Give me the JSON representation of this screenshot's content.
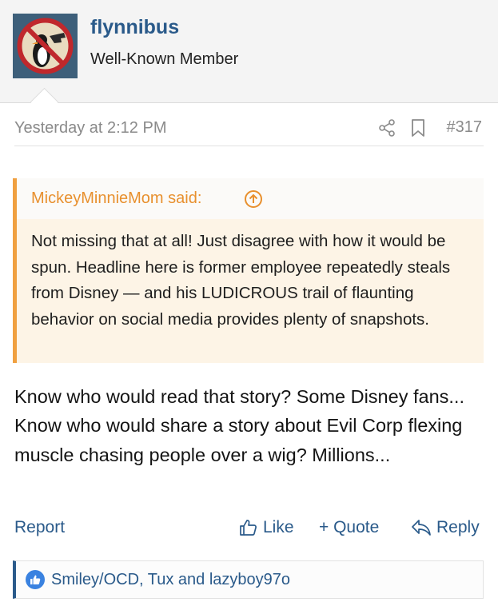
{
  "user": {
    "name": "flynnibus",
    "title": "Well-Known Member"
  },
  "post": {
    "date": "Yesterday at 2:12 PM",
    "number": "#317",
    "body": "Know who would read that story? Some Disney fans... Know who would share a story about Evil Corp flexing muscle chasing people over a wig? Millions..."
  },
  "quote": {
    "author": "MickeyMinnieMom said:",
    "text": "Not missing that at all! Just disagree with how it would be spun. Headline here is former employee repeatedly steals from Disney — and his LUDICROUS trail of flaunting behavior on social media provides plenty of snapshots."
  },
  "actions": {
    "report": "Report",
    "like": "Like",
    "quote": "+ Quote",
    "reply": "Reply"
  },
  "reactions": {
    "users": "Smiley/OCD, Tux and lazyboy97o"
  },
  "colors": {
    "link": "#2a5a8a",
    "quote_accent": "#f0a040",
    "quote_bg": "#fdf4e6",
    "like_badge": "#3a82e0"
  }
}
